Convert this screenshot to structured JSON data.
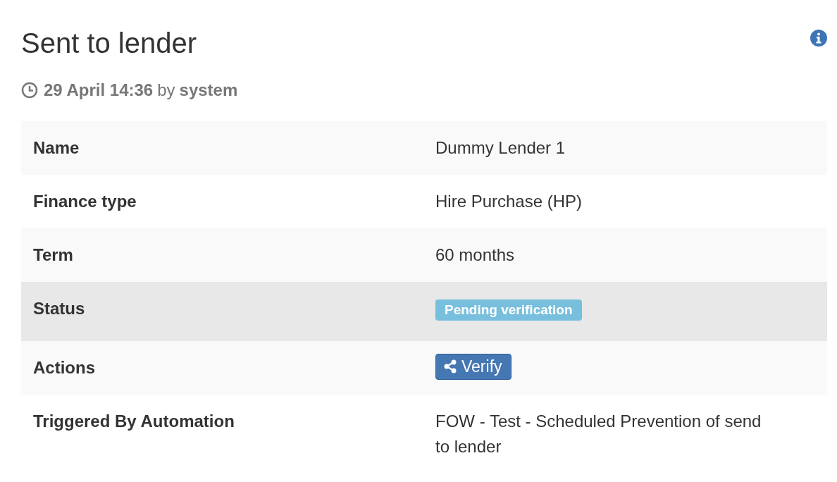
{
  "title": "Sent to lender",
  "meta": {
    "timestamp": "29 April 14:36",
    "by": "by",
    "author": "system"
  },
  "rows": [
    {
      "label": "Name",
      "kind": "text",
      "value": "Dummy Lender 1",
      "highlighted": false
    },
    {
      "label": "Finance type",
      "kind": "text",
      "value": "Hire Purchase (HP)",
      "highlighted": false
    },
    {
      "label": "Term",
      "kind": "text",
      "value": "60 months",
      "highlighted": false
    },
    {
      "label": "Status",
      "kind": "badge",
      "value": "Pending verification",
      "highlighted": true
    },
    {
      "label": "Actions",
      "kind": "button",
      "value": "Verify",
      "highlighted": false
    },
    {
      "label": "Triggered By Automation",
      "kind": "text",
      "value": "FOW - Test - Scheduled Prevention of send to lender",
      "highlighted": false
    }
  ]
}
